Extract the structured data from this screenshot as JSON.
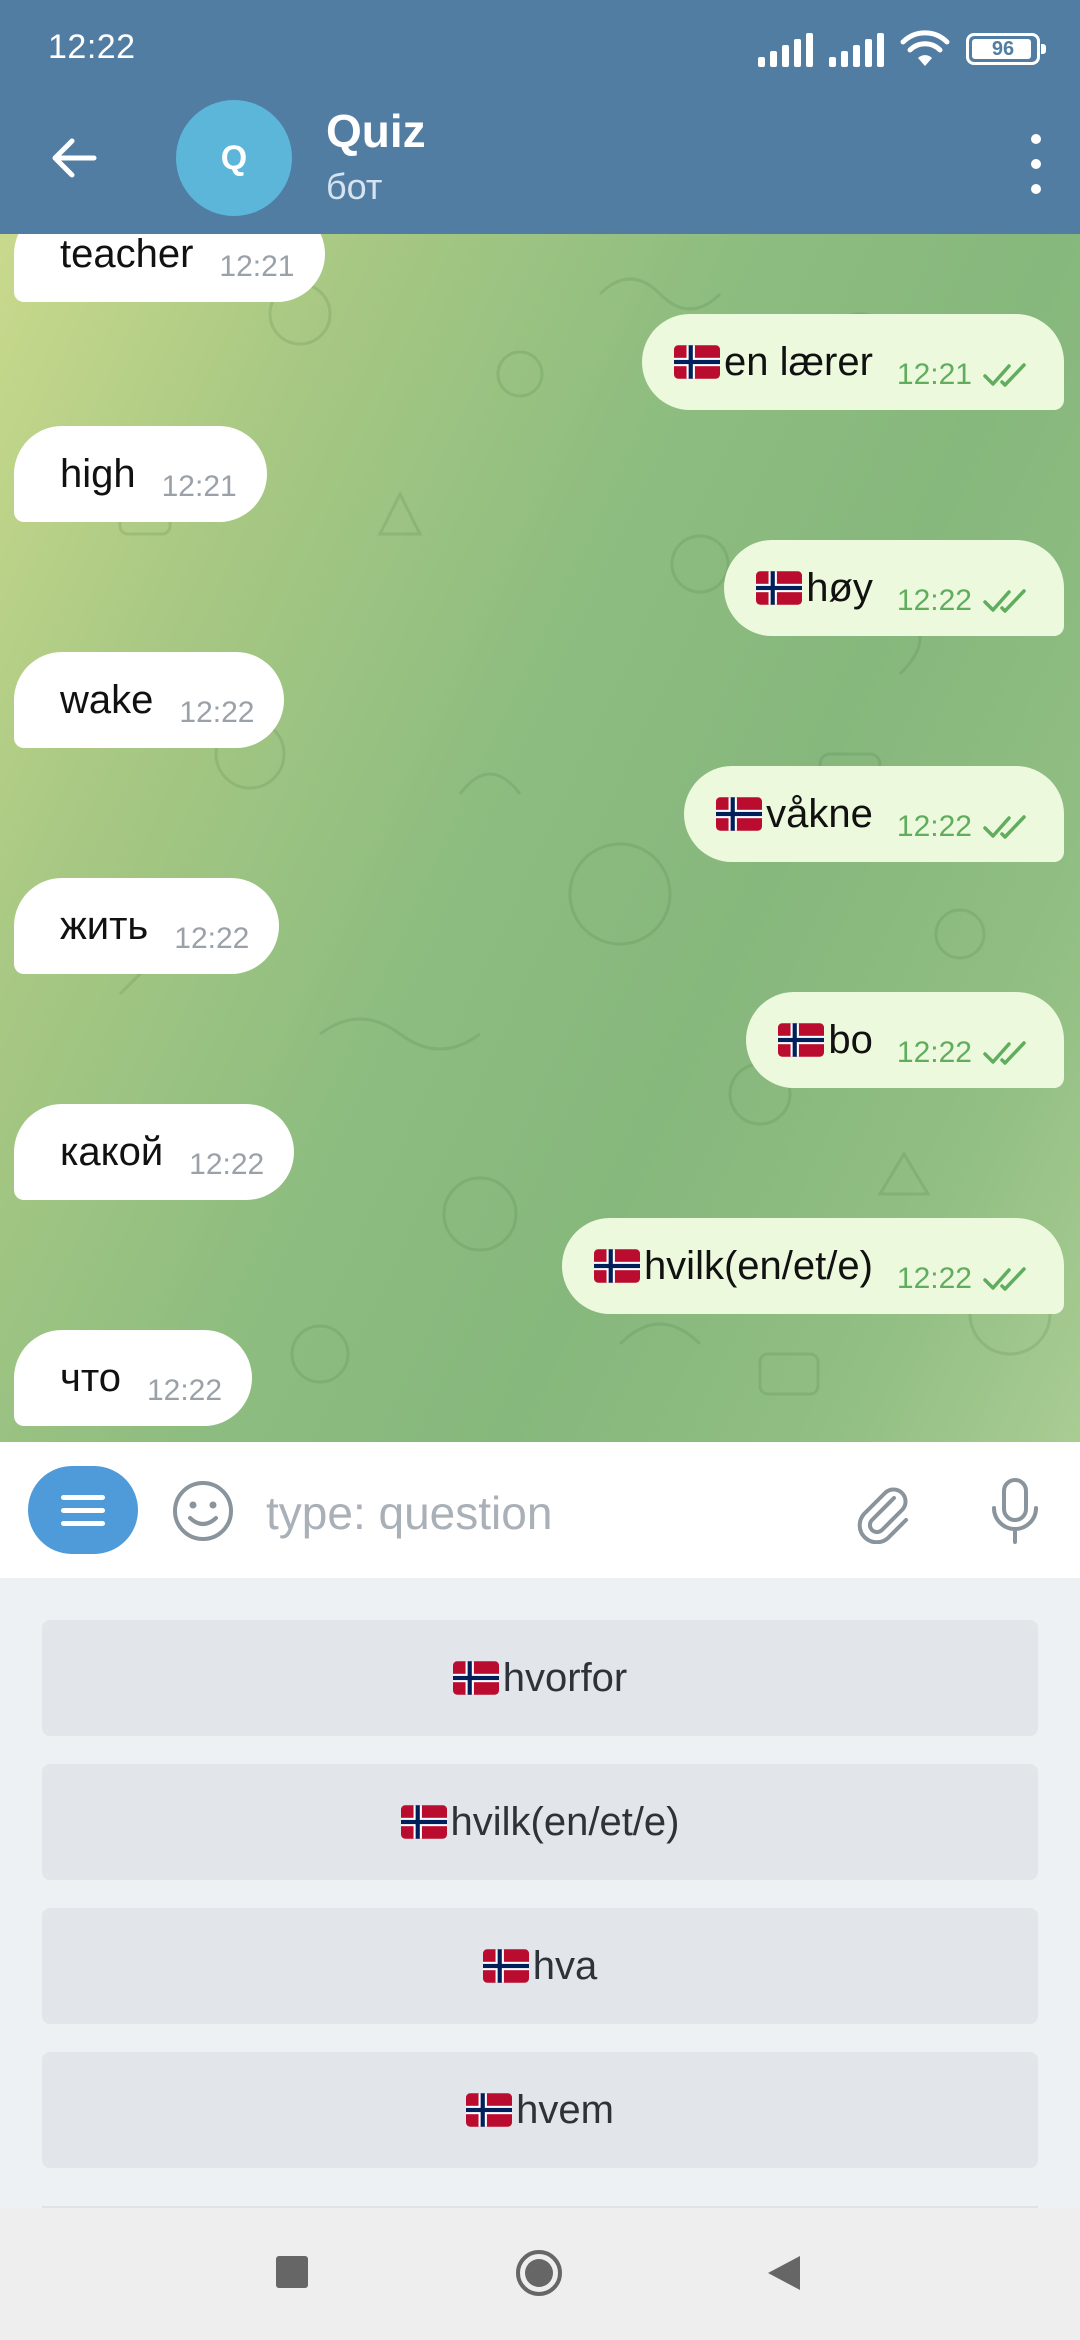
{
  "status_bar": {
    "time": "12:22",
    "battery": "96"
  },
  "header": {
    "avatar_letter": "Q",
    "title": "Quiz",
    "subtitle": "бот"
  },
  "messages": [
    {
      "dir": "in",
      "text": "teacher",
      "time": "12:21"
    },
    {
      "dir": "out",
      "flag": true,
      "text": "en lærer",
      "time": "12:21"
    },
    {
      "dir": "in",
      "text": "high",
      "time": "12:21"
    },
    {
      "dir": "out",
      "flag": true,
      "text": "høy",
      "time": "12:22"
    },
    {
      "dir": "in",
      "text": "wake",
      "time": "12:22"
    },
    {
      "dir": "out",
      "flag": true,
      "text": "våkne",
      "time": "12:22"
    },
    {
      "dir": "in",
      "text": "жить",
      "time": "12:22"
    },
    {
      "dir": "out",
      "flag": true,
      "text": "bo",
      "time": "12:22"
    },
    {
      "dir": "in",
      "text": "какой",
      "time": "12:22"
    },
    {
      "dir": "out",
      "flag": true,
      "text": "hvilk(en/et/e)",
      "time": "12:22"
    },
    {
      "dir": "in",
      "text": "что",
      "time": "12:22"
    }
  ],
  "input": {
    "placeholder": "type: question"
  },
  "keyboard_buttons": [
    {
      "flag": true,
      "text": "hvorfor"
    },
    {
      "flag": true,
      "text": "hvilk(en/et/e)"
    },
    {
      "flag": true,
      "text": "hva"
    },
    {
      "flag": true,
      "text": "hvem"
    }
  ],
  "icons": {
    "back": "arrow-left-icon",
    "more": "more-vertical-icon",
    "menu": "menu-icon",
    "emoji": "smiley-icon",
    "attach": "paperclip-icon",
    "mic": "microphone-icon",
    "flag": "norway-flag-icon",
    "read": "double-check-icon"
  },
  "colors": {
    "header": "#527da3",
    "outgoing": "#ecf9dd",
    "incoming": "#ffffff",
    "accent": "#4f9ad9"
  }
}
